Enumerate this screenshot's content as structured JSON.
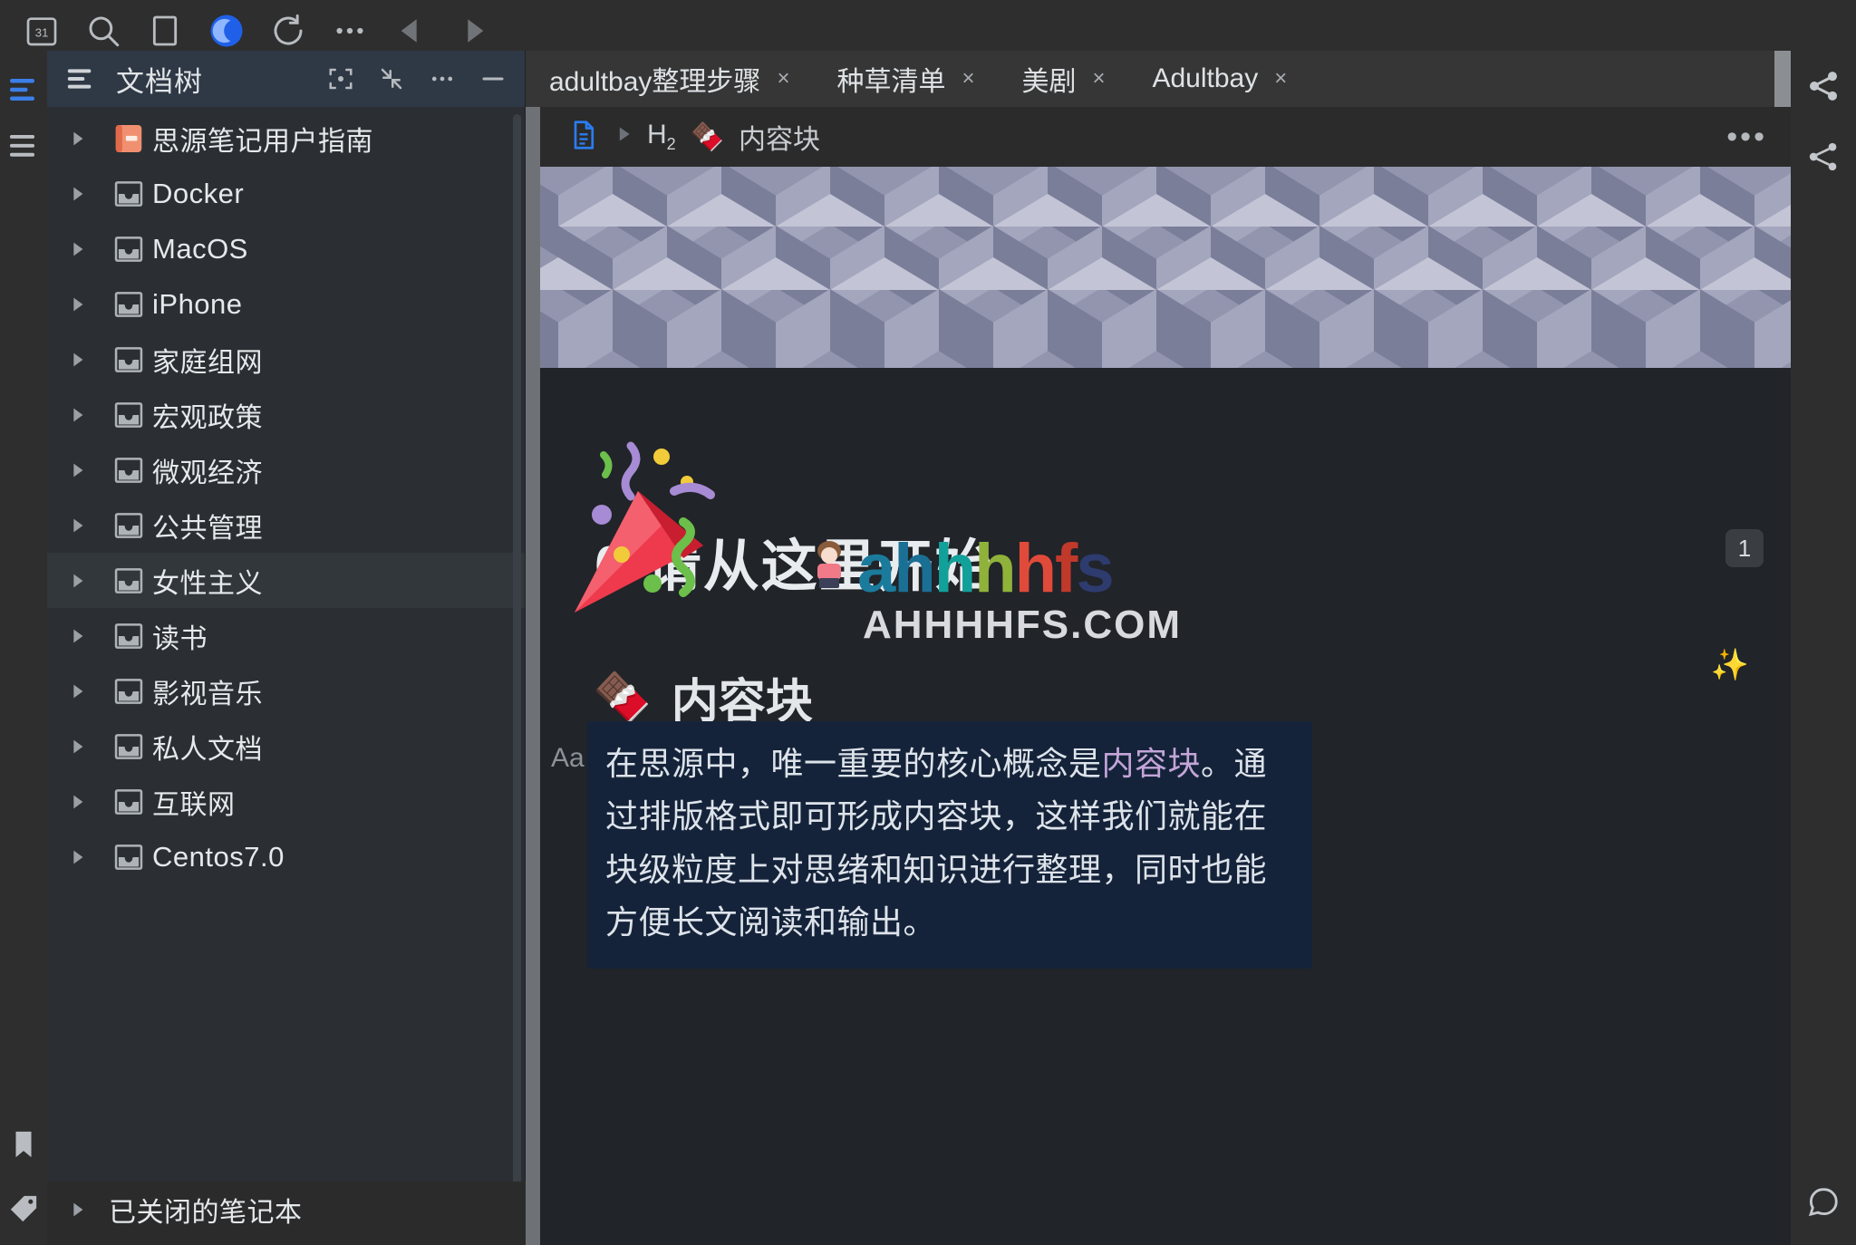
{
  "toolbar": {
    "items": [
      {
        "name": "calendar-icon",
        "label": "31"
      },
      {
        "name": "search-icon",
        "label": ""
      },
      {
        "name": "window-icon",
        "label": ""
      },
      {
        "name": "theme-moon-icon",
        "label": ""
      },
      {
        "name": "sync-icon",
        "label": ""
      },
      {
        "name": "more-icon",
        "label": "•••"
      },
      {
        "name": "back-icon",
        "label": ""
      },
      {
        "name": "forward-icon",
        "label": ""
      }
    ]
  },
  "left_dock": {
    "items": [
      {
        "name": "dock-doc-tree",
        "active": true
      },
      {
        "name": "dock-outline",
        "active": false
      },
      {
        "name": "dock-bookmark",
        "active": false
      },
      {
        "name": "dock-tag",
        "active": false
      }
    ]
  },
  "tree_panel": {
    "title": "文档树",
    "header_buttons": [
      "focus-icon",
      "collapse-icon",
      "more-icon",
      "minimize-icon"
    ],
    "items": [
      {
        "label": "思源笔记用户指南",
        "icon": "book-icon",
        "highlight": false
      },
      {
        "label": "Docker",
        "icon": "notebook-icon",
        "highlight": false
      },
      {
        "label": "MacOS",
        "icon": "notebook-icon",
        "highlight": false
      },
      {
        "label": "iPhone",
        "icon": "notebook-icon",
        "highlight": false
      },
      {
        "label": "家庭组网",
        "icon": "notebook-icon",
        "highlight": false
      },
      {
        "label": "宏观政策",
        "icon": "notebook-icon",
        "highlight": false
      },
      {
        "label": "微观经济",
        "icon": "notebook-icon",
        "highlight": false
      },
      {
        "label": "公共管理",
        "icon": "notebook-icon",
        "highlight": false
      },
      {
        "label": "女性主义",
        "icon": "notebook-icon",
        "highlight": true
      },
      {
        "label": "读书",
        "icon": "notebook-icon",
        "highlight": false
      },
      {
        "label": "影视音乐",
        "icon": "notebook-icon",
        "highlight": false
      },
      {
        "label": "私人文档",
        "icon": "notebook-icon",
        "highlight": false
      },
      {
        "label": "互联网",
        "icon": "notebook-icon",
        "highlight": false
      },
      {
        "label": "Centos7.0",
        "icon": "notebook-icon",
        "highlight": false
      },
      {
        "label": "已关闭的笔记本",
        "icon": "none",
        "highlight": false
      }
    ]
  },
  "tabs": [
    {
      "label": "adultbay整理步骤",
      "close": "×",
      "active": false
    },
    {
      "label": "种草清单",
      "close": "×",
      "active": false
    },
    {
      "label": "美剧",
      "close": "×",
      "active": false
    },
    {
      "label": "Adultbay",
      "close": "×",
      "active": true
    }
  ],
  "editor": {
    "breadcrumb": {
      "doc_icon": "document-icon",
      "separator": "▶",
      "heading_level": "H",
      "heading_sub": "2",
      "emoji": "🍫",
      "text": "内容块",
      "more": "•••"
    },
    "doc_title": "0 请从这里开始",
    "heading2": {
      "emoji": "🍫",
      "text": "内容块"
    },
    "paragraph_gutter": "Aa",
    "paragraph": {
      "part1": "在思源中，唯一重要的核心概念是",
      "ref": "内容块",
      "part2": "。通过排版格式即可形成内容块，这样我们就能在块级粒度上对思绪和知识进行整理，同时也能方便长文阅读和输出。"
    },
    "block_badge": "1",
    "sparkle": "✨"
  },
  "right_dock": {
    "items": [
      {
        "name": "share-icon"
      },
      {
        "name": "graph-icon"
      },
      {
        "name": "backlink-icon"
      }
    ]
  },
  "watermark": {
    "main": "ahhhhfs",
    "sub": "AHHHHFS.COM"
  },
  "colors": {
    "accent": "#3b7fe8",
    "tree_header_bg": "#2f3845",
    "selection_bg": "#15233a",
    "ref_color": "#c3a5d8"
  }
}
